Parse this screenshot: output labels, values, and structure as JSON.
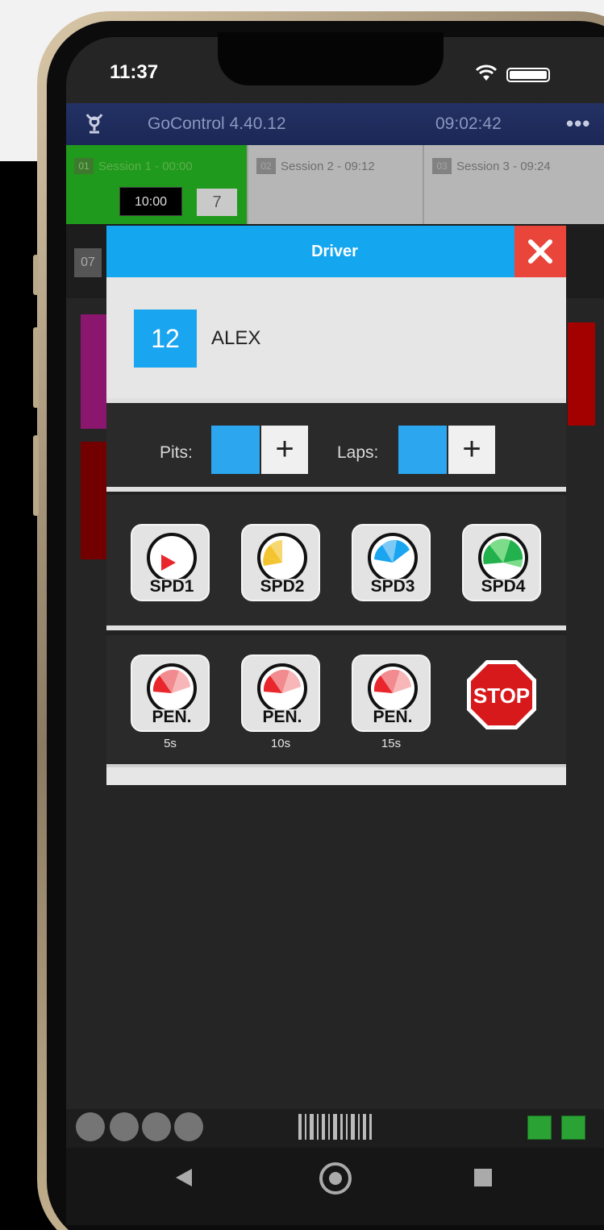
{
  "status_bar": {
    "time": "11:37"
  },
  "app": {
    "title": "GoControl 4.40.12",
    "clock": "09:02:42",
    "more": "•••"
  },
  "sessions": [
    {
      "num": "01",
      "label": "Session 1 - 00:00",
      "time": "10:00",
      "count": "7"
    },
    {
      "num": "02",
      "label": "Session 2 - 09:12"
    },
    {
      "num": "03",
      "label": "Session 3 - 09:24"
    }
  ],
  "background": {
    "row_num": "07"
  },
  "modal": {
    "title": "Driver",
    "close": "✕",
    "driver_number": "12",
    "driver_name": "ALEX",
    "pits_label": "Pits:",
    "laps_label": "Laps:",
    "plus": "+"
  },
  "speed_buttons": [
    {
      "label": "SPD1",
      "color": "#e8262b"
    },
    {
      "label": "SPD2",
      "color": "#f4c430"
    },
    {
      "label": "SPD3",
      "color": "#1aa5f0"
    },
    {
      "label": "SPD4",
      "color": "#22b14c"
    }
  ],
  "penalty_buttons": [
    {
      "label": "PEN.",
      "sub": "5s"
    },
    {
      "label": "PEN.",
      "sub": "10s"
    },
    {
      "label": "PEN.",
      "sub": "15s"
    }
  ],
  "stop_button": {
    "label": "STOP",
    "color": "#d7191c"
  },
  "colors": {
    "header_blue": "#14a6ef",
    "close_red": "#e9453a",
    "session_green": "#1f9a1c"
  }
}
